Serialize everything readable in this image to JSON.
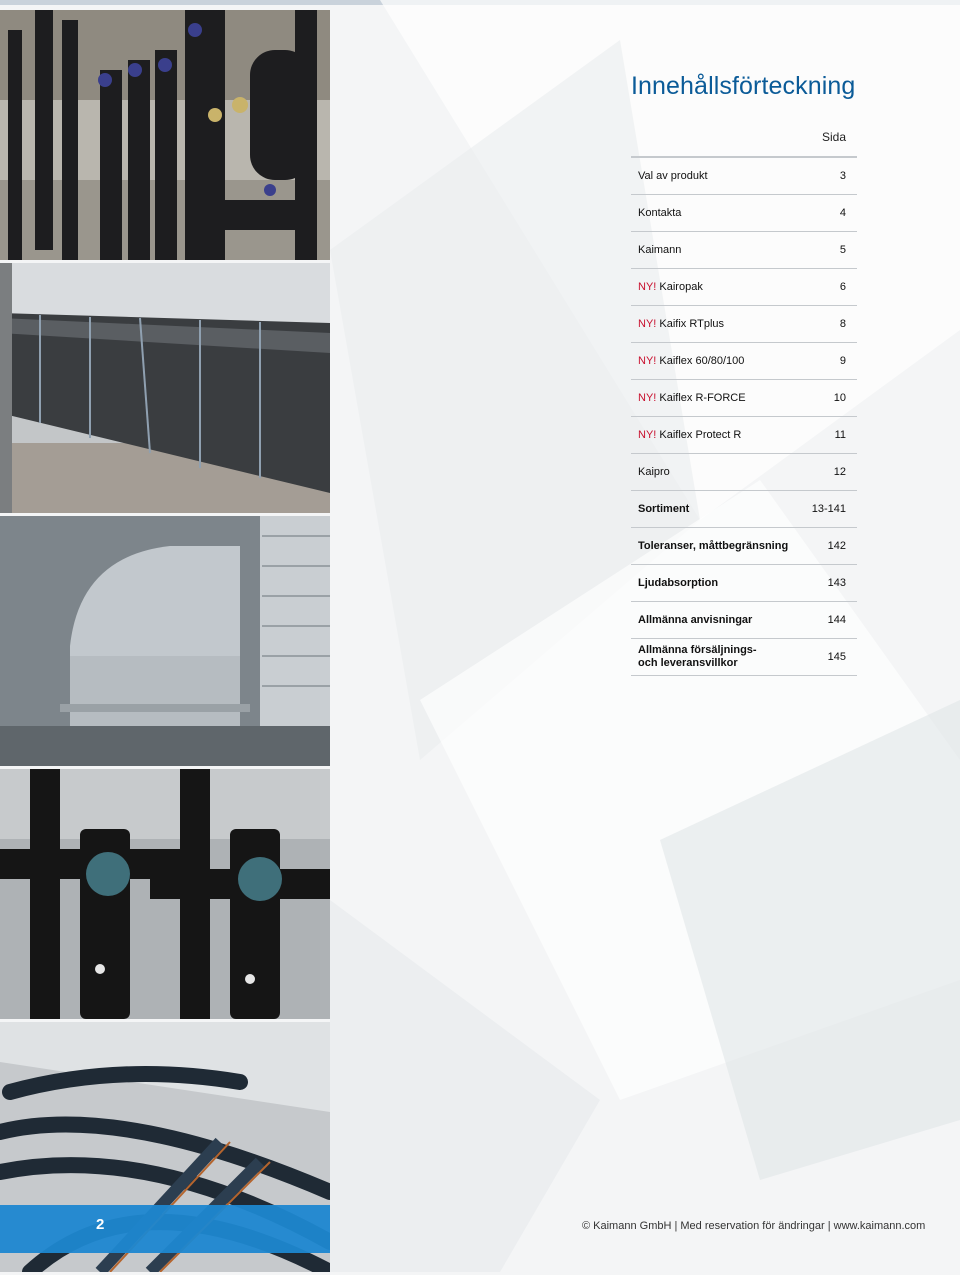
{
  "title": "Innehållsförteckning",
  "column_header": "Sida",
  "entries": [
    {
      "prefix": "",
      "label": "Val av produkt",
      "page": "3"
    },
    {
      "prefix": "",
      "label": "Kontakta",
      "page": "4"
    },
    {
      "prefix": "",
      "label": "Kaimann",
      "page": "5"
    },
    {
      "prefix": "NY!",
      "label": "Kairopak",
      "page": "6"
    },
    {
      "prefix": "NY!",
      "label": "Kaifix RTplus",
      "page": "8"
    },
    {
      "prefix": "NY!",
      "label": "Kaiflex 60/80/100",
      "page": "9"
    },
    {
      "prefix": "NY!",
      "label": "Kaiflex R-FORCE",
      "page": "10"
    },
    {
      "prefix": "NY!",
      "label": "Kaiflex Protect R",
      "page": "11"
    },
    {
      "prefix": "",
      "label": "Kaipro",
      "page": "12"
    },
    {
      "prefix": "",
      "label": "Sortiment",
      "page": "13-141"
    },
    {
      "prefix": "",
      "label": "Toleranser, måttbegränsning",
      "page": "142"
    },
    {
      "prefix": "",
      "label": "Ljudabsorption",
      "page": "143"
    },
    {
      "prefix": "",
      "label": "Allmänna anvisningar",
      "page": "144"
    },
    {
      "prefix": "",
      "label_line1": "Allmänna försäljnings-",
      "label_line2": "och leveransvillkor",
      "page": "145"
    }
  ],
  "page_number": "2",
  "footer": "© Kaimann GmbH | Med reservation för ändringar | www.kaimann.com",
  "colors": {
    "accent_blue": "#0b5b98",
    "new_red": "#c8102e",
    "footer_bar": "#1e87d0"
  }
}
